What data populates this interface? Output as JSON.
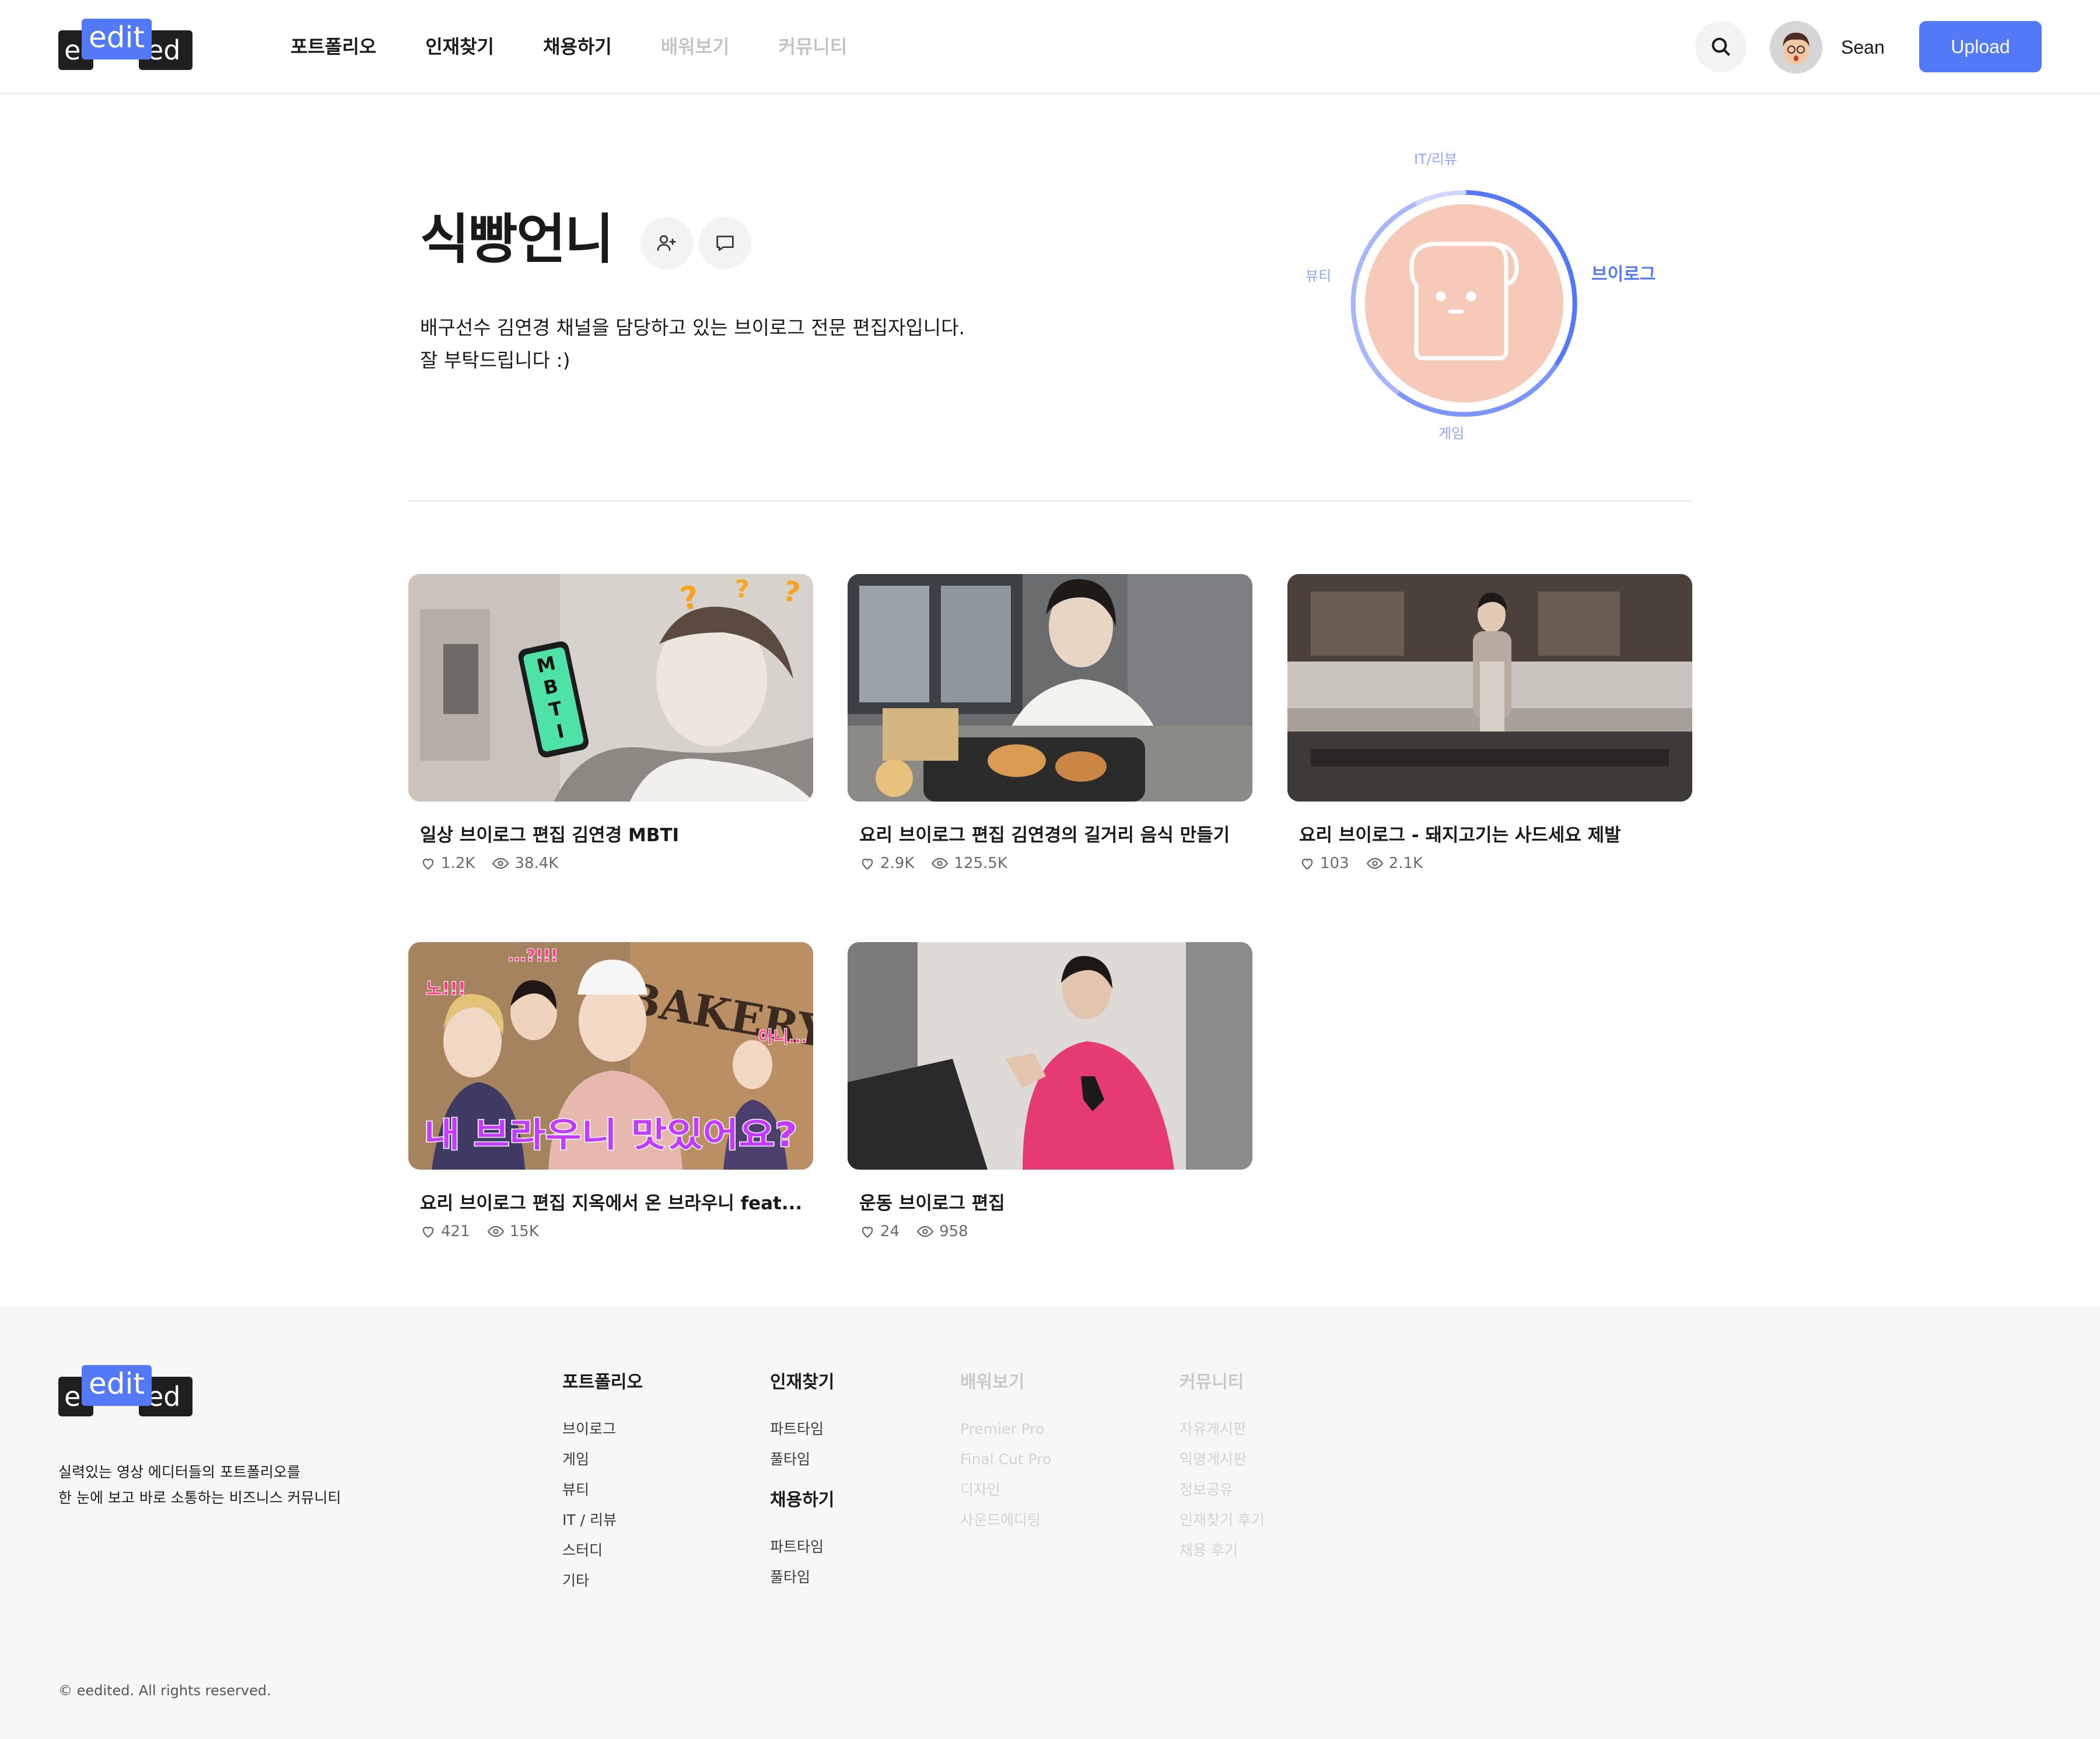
{
  "header": {
    "logo": {
      "left": "e",
      "edit": "edit",
      "right": "ed"
    },
    "nav": [
      {
        "label": "포트폴리오",
        "active": true
      },
      {
        "label": "인재찾기",
        "active": true
      },
      {
        "label": "채용하기",
        "active": true
      },
      {
        "label": "배워보기",
        "active": false
      },
      {
        "label": "커뮤니티",
        "active": false
      }
    ],
    "user_name": "Sean",
    "upload_label": "Upload"
  },
  "profile": {
    "name": "식빵언니",
    "bio_line1": "배구선수 김연경 채널을 담당하고 있는 브이로그 전문 편집자입니다.",
    "bio_line2": "잘 부탁드립니다 :)",
    "categories": {
      "top": "IT/리뷰",
      "left": "뷰티",
      "right": "브이로그",
      "bottom": "게임"
    },
    "colors": {
      "accent": "#5479f7",
      "avatar_bg": "#f6c9b8"
    }
  },
  "videos": [
    {
      "title": "일상 브이로그 편집 김연경 MBTI",
      "likes": "1.2K",
      "views": "38.4K",
      "thumb_text": "MBTI"
    },
    {
      "title": "요리 브이로그 편집 김연경의 길거리 음식 만들기",
      "likes": "2.9K",
      "views": "125.5K"
    },
    {
      "title": "요리 브이로그 - 돼지고기는 사드세요 제발",
      "likes": "103",
      "views": "2.1K"
    },
    {
      "title": "요리 브이로그 편집 지옥에서 온 브라우니 feat...",
      "likes": "421",
      "views": "15K",
      "thumb_text": "내 브라우니 맛있어요?",
      "thumb_sign": "BAKERY",
      "thumb_tag1": "노!!!",
      "thumb_tag2": "...?!!!",
      "thumb_tag3": "아니..."
    },
    {
      "title": "운동 브이로그 편집",
      "likes": "24",
      "views": "958"
    }
  ],
  "footer": {
    "logo": {
      "left": "e",
      "edit": "edit",
      "right": "ed"
    },
    "tagline1": "실력있는 영상 에디터들의 포트폴리오를",
    "tagline2": "한 눈에 보고 바로 소통하는 비즈니스 커뮤니티",
    "portfolio": {
      "head": "포트폴리오",
      "items": [
        "브이로그",
        "게임",
        "뷰티",
        "IT / 리뷰",
        "스터디",
        "기타"
      ]
    },
    "talent": {
      "head": "인재찾기",
      "items": [
        "파트타임",
        "풀타임"
      ]
    },
    "hire": {
      "head": "채용하기",
      "items": [
        "파트타임",
        "풀타임"
      ]
    },
    "learn": {
      "head": "배워보기",
      "items": [
        "Premier Pro",
        "Final Cut Pro",
        "디자인",
        "사운드에디팅"
      ]
    },
    "community": {
      "head": "커뮤니티",
      "items": [
        "자유게시판",
        "익명게시판",
        "정보공유",
        "인재찾기 후기",
        "채용 후기"
      ]
    },
    "copyright": "© eedited. All rights reserved."
  }
}
